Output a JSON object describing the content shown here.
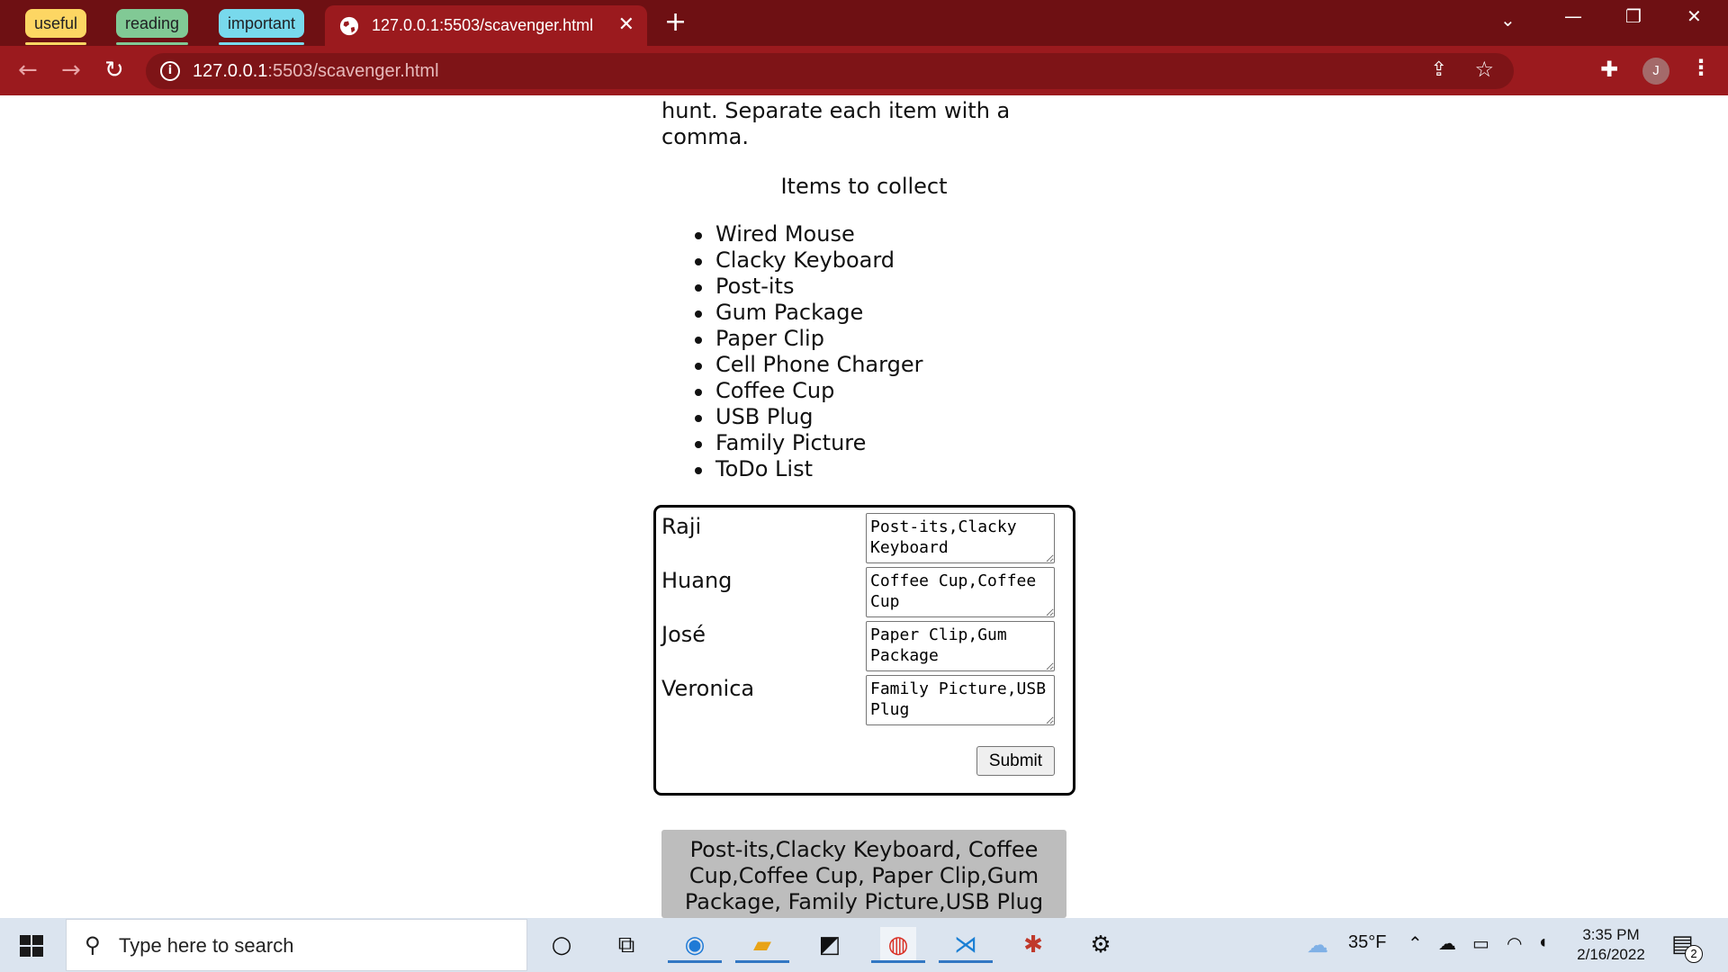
{
  "browser": {
    "tab_groups": [
      "useful",
      "reading",
      "important"
    ],
    "active_tab_title": "127.0.0.1:5503/scavenger.html",
    "url_host": "127.0.0.1",
    "url_rest": ":5503/scavenger.html",
    "profile_initial": "J",
    "colors": {
      "frame": "#6e1013",
      "toolbar": "#9b1a1e",
      "omnibox": "#7e1417"
    }
  },
  "page": {
    "intro_text": "hunt. Separate each item with a comma.",
    "items_heading": "Items to collect",
    "items": [
      "Wired Mouse",
      "Clacky Keyboard",
      "Post-its",
      "Gum Package",
      "Paper Clip",
      "Cell Phone Charger",
      "Coffee Cup",
      "USB Plug",
      "Family Picture",
      "ToDo List"
    ],
    "participants": [
      {
        "name": "Raji",
        "entry": "Post-its,Clacky Keyboard"
      },
      {
        "name": "Huang",
        "entry": "Coffee Cup,Coffee Cup"
      },
      {
        "name": "José",
        "entry": "Paper Clip,Gum Package"
      },
      {
        "name": "Veronica",
        "entry": "Family Picture,USB Plug"
      }
    ],
    "submit_label": "Submit",
    "result_text": "Post-its,Clacky Keyboard, Coffee Cup,Coffee Cup, Paper Clip,Gum Package, Family Picture,USB Plug"
  },
  "taskbar": {
    "search_placeholder": "Type here to search",
    "temperature": "35°F",
    "time": "3:35 PM",
    "date": "2/16/2022",
    "notification_count": "2"
  }
}
